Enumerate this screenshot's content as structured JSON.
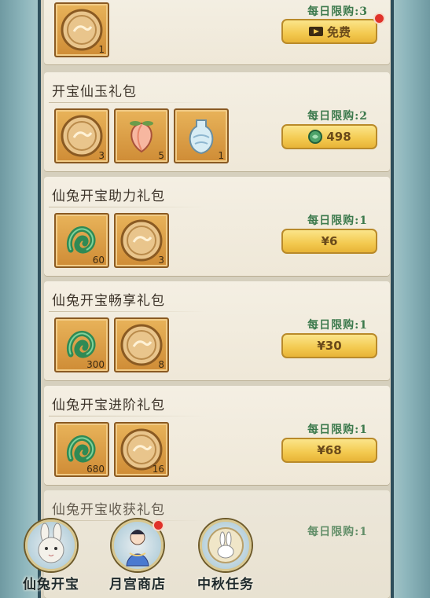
{
  "cards": [
    {
      "title": "",
      "items": [
        {
          "icon": "mooncake-icon",
          "qty": "1"
        }
      ],
      "limit": "每日限购:3",
      "button": {
        "icon": "video-icon",
        "label": "免费"
      },
      "has_dot": true
    },
    {
      "title": "开宝仙玉礼包",
      "items": [
        {
          "icon": "mooncake-icon",
          "qty": "3"
        },
        {
          "icon": "peach-icon",
          "qty": "5"
        },
        {
          "icon": "vase-icon",
          "qty": "1"
        }
      ],
      "limit": "每日限购:2",
      "button": {
        "icon": "jade-coin-icon",
        "label": "498"
      },
      "has_dot": false
    },
    {
      "title": "仙兔开宝助力礼包",
      "items": [
        {
          "icon": "jade-dragon-icon",
          "qty": "60"
        },
        {
          "icon": "mooncake-icon",
          "qty": "3"
        }
      ],
      "limit": "每日限购:1",
      "button": {
        "icon": "",
        "label": "¥6"
      },
      "has_dot": false
    },
    {
      "title": "仙兔开宝畅享礼包",
      "items": [
        {
          "icon": "jade-dragon-icon",
          "qty": "300"
        },
        {
          "icon": "mooncake-icon",
          "qty": "8"
        }
      ],
      "limit": "每日限购:1",
      "button": {
        "icon": "",
        "label": "¥30"
      },
      "has_dot": false
    },
    {
      "title": "仙兔开宝进阶礼包",
      "items": [
        {
          "icon": "jade-dragon-icon",
          "qty": "680"
        },
        {
          "icon": "mooncake-icon",
          "qty": "16"
        }
      ],
      "limit": "每日限购:1",
      "button": {
        "icon": "",
        "label": "¥68"
      },
      "has_dot": false
    },
    {
      "title": "仙兔开宝收获礼包",
      "items": [],
      "limit": "每日限购:1",
      "button": null,
      "has_dot": false
    }
  ],
  "nav": [
    {
      "label": "仙兔开宝",
      "icon": "rabbit-icon",
      "has_dot": false
    },
    {
      "label": "月宫商店",
      "icon": "moon-goddess-icon",
      "has_dot": true
    },
    {
      "label": "中秋任务",
      "icon": "moon-rabbit-icon",
      "has_dot": false
    }
  ],
  "colors": {
    "limit_text": "#3d7a4d",
    "button_gold": "#f3c94f",
    "alert_red": "#e0322a"
  }
}
